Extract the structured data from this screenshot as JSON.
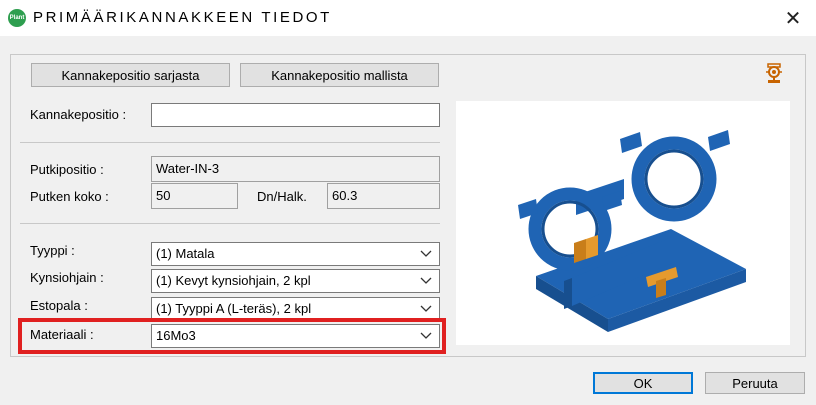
{
  "window": {
    "app_icon_text": "Plant",
    "title": "PRIMÄÄRIKANNAKKEEN TIEDOT",
    "close_glyph": "✕"
  },
  "toolbar": {
    "from_series_label": "Kannakepositio sarjasta",
    "from_model_label": "Kannakepositio mallista",
    "config_icon": "support-config-icon",
    "accent_color": "#c86400"
  },
  "form": {
    "kannakepositio": {
      "label": "Kannakepositio :",
      "value": ""
    },
    "putkipositio": {
      "label": "Putkipositio :",
      "value": "Water-IN-3"
    },
    "putken_koko": {
      "label": "Putken koko :",
      "value": "50"
    },
    "dn_halk": {
      "label": "Dn/Halk.",
      "value": "60.3"
    },
    "tyyppi": {
      "label": "Tyyppi :",
      "value": "(1) Matala"
    },
    "kynsiohjain": {
      "label": "Kynsiohjain :",
      "value": "(1) Kevyt kynsiohjain, 2 kpl"
    },
    "estopala": {
      "label": "Estopala :",
      "value": "(1) Tyyppi A (L-teräs), 2 kpl"
    },
    "materiaali": {
      "label": "Materiaali :",
      "value": "16Mo3"
    }
  },
  "preview": {
    "icon": "pipe-support-3d-model",
    "primary_color": "#1f64b4",
    "secondary_color": "#e59a2e"
  },
  "highlight_color": "#e02020",
  "footer": {
    "ok_label": "OK",
    "cancel_label": "Peruuta"
  }
}
